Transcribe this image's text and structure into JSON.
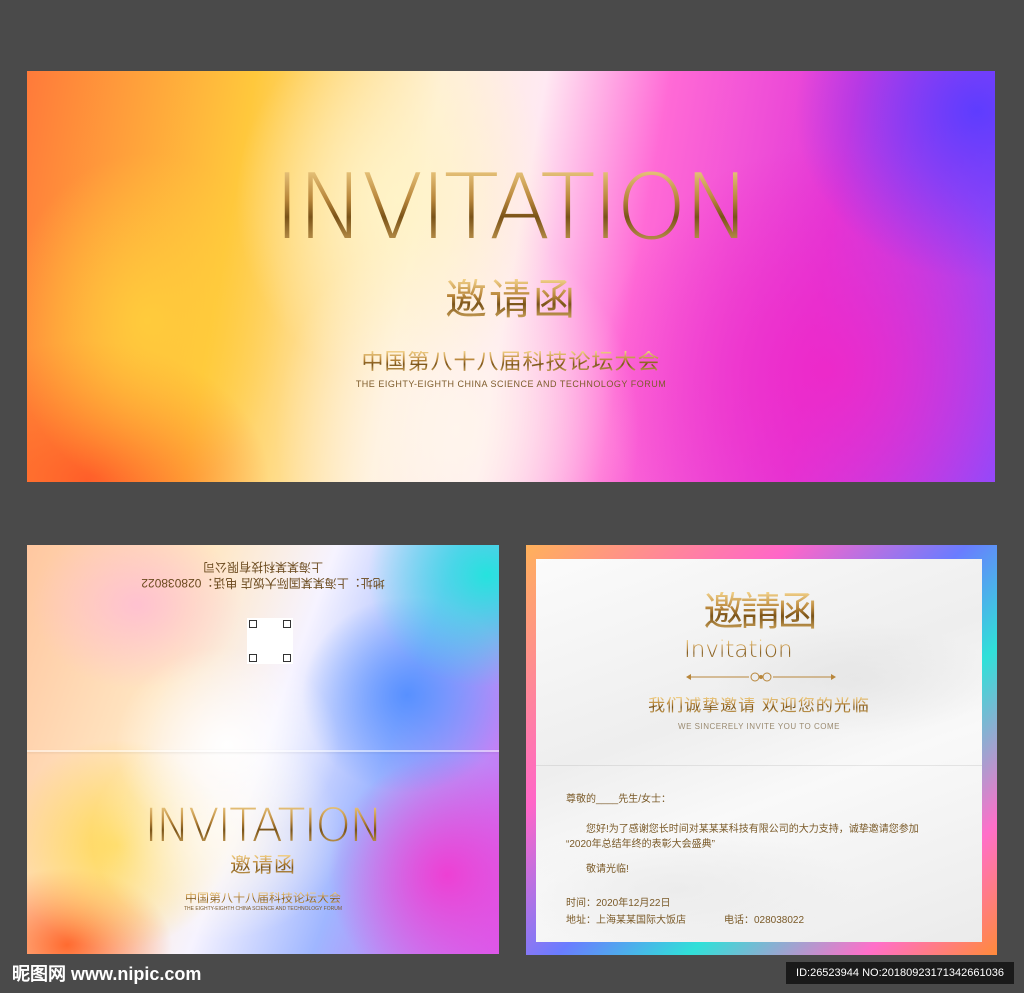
{
  "top_card": {
    "title": "INVITATION",
    "cn_title": "邀请函",
    "cn_subtitle": "中国第八十八届科技论坛大会",
    "en_subtitle": "THE EIGHTY-EIGHTH CHINA SCIENCE AND TECHNOLOGY FORUM"
  },
  "bottom_left_card": {
    "flipped_line_1": "地址：上海某某国际大饭店 电话：028038022",
    "flipped_line_2": "上海某某科技有限公司",
    "title": "INVITATION",
    "cn_title": "邀请函",
    "cn_subtitle": "中国第八十八届科技论坛大会",
    "en_subtitle": "THE EIGHTY-EIGHTH CHINA SCIENCE AND TECHNOLOGY FORUM"
  },
  "bottom_right_card": {
    "big_cn_title": "邀請函",
    "script_title": "Invitation",
    "tagline": "我们诚挚邀请 欢迎您的光临",
    "tagline_en": "WE SINCERELY INVITE YOU TO COME",
    "salutation": "尊敬的____先生/女士：",
    "body_line_1": "您好!为了感谢您长时间对某某某科技有限公司的大力支持，诚挚邀请您参加",
    "body_line_2": "“2020年总结年终的表彰大会盛典”",
    "closing": "敬请光临!",
    "time": "时间：2020年12月22日",
    "address": "地址：上海某某国际大饭店",
    "phone": "电话：028038022"
  },
  "watermark": {
    "site": "昵图网 www.nipic.com",
    "id_text": "ID:26523944 NO:20180923171342661036"
  },
  "colors": {
    "background": "#4a4a4a",
    "gold": "#b8863b"
  }
}
